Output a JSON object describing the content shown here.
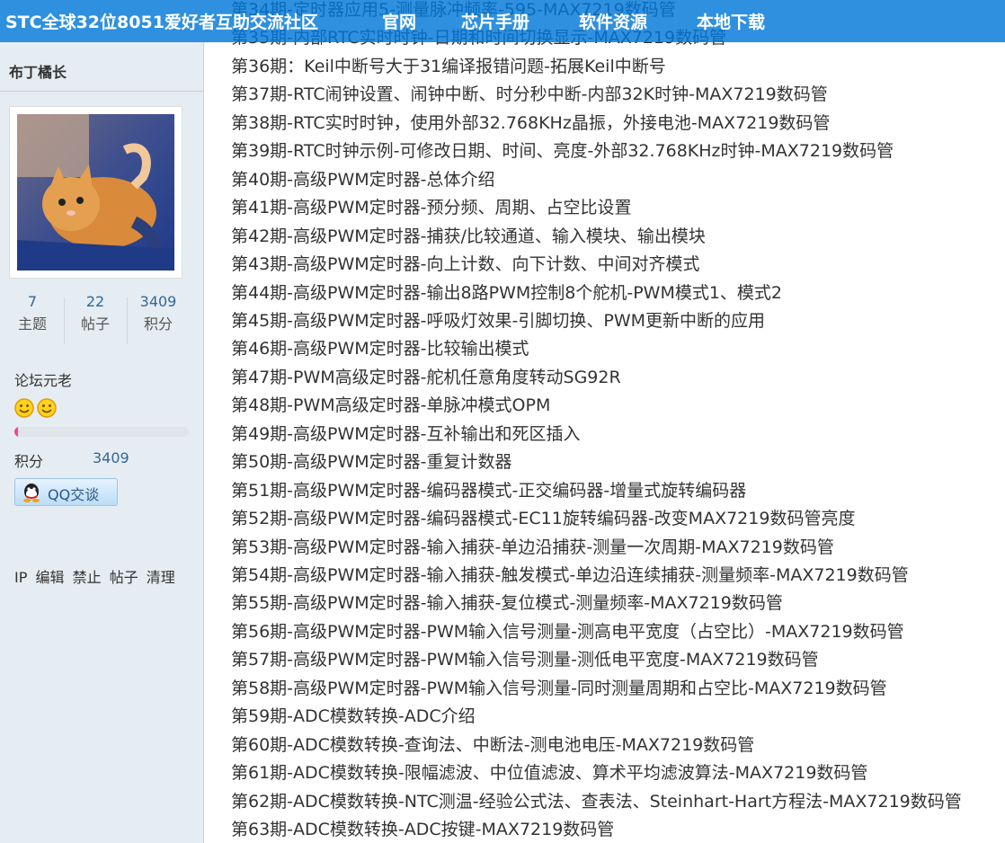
{
  "nav": {
    "site_title": "STC全球32位8051爱好者互助交流社区",
    "items": [
      "官网",
      "芯片手册",
      "软件资源",
      "本地下载"
    ]
  },
  "profile": {
    "username": "布丁橘长",
    "stats": [
      {
        "value": "7",
        "label": "主题"
      },
      {
        "value": "22",
        "label": "帖子"
      },
      {
        "value": "3409",
        "label": "积分"
      }
    ],
    "rank": "论坛元老",
    "progress_fraction": 0.02,
    "points_label": "积分",
    "points_value": "3409",
    "qq_label": "QQ交谈",
    "admin_links": [
      "IP",
      "编辑",
      "禁止",
      "帖子",
      "清理"
    ]
  },
  "lessons": [
    "第34期-定时器应用5-测量脉冲频率-595-MAX7219数码管",
    "第35期-内部RTC实时时钟-日期和时间切换显示-MAX7219数码管",
    "第36期：Keil中断号大于31编译报错问题-拓展Keil中断号",
    "第37期-RTC闹钟设置、闹钟中断、时分秒中断-内部32K时钟-MAX7219数码管",
    "第38期-RTC实时时钟，使用外部32.768KHz晶振，外接电池-MAX7219数码管",
    "第39期-RTC时钟示例-可修改日期、时间、亮度-外部32.768KHz时钟-MAX7219数码管",
    "第40期-高级PWM定时器-总体介绍",
    "第41期-高级PWM定时器-预分频、周期、占空比设置",
    "第42期-高级PWM定时器-捕获/比较通道、输入模块、输出模块",
    "第43期-高级PWM定时器-向上计数、向下计数、中间对齐模式",
    "第44期-高级PWM定时器-输出8路PWM控制8个舵机-PWM模式1、模式2",
    "第45期-高级PWM定时器-呼吸灯效果-引脚切换、PWM更新中断的应用",
    "第46期-高级PWM定时器-比较输出模式",
    "第47期-PWM高级定时器-舵机任意角度转动SG92R",
    "第48期-PWM高级定时器-单脉冲模式OPM",
    "第49期-高级PWM定时器-互补输出和死区插入",
    "第50期-高级PWM定时器-重复计数器",
    "第51期-高级PWM定时器-编码器模式-正交编码器-增量式旋转编码器",
    "第52期-高级PWM定时器-编码器模式-EC11旋转编码器-改变MAX7219数码管亮度",
    "第53期-高级PWM定时器-输入捕获-单边沿捕获-测量一次周期-MAX7219数码管",
    "第54期-高级PWM定时器-输入捕获-触发模式-单边沿连续捕获-测量频率-MAX7219数码管",
    "第55期-高级PWM定时器-输入捕获-复位模式-测量频率-MAX7219数码管",
    "第56期-高级PWM定时器-PWM输入信号测量-测高电平宽度（占空比）-MAX7219数码管",
    "第57期-高级PWM定时器-PWM输入信号测量-测低电平宽度-MAX7219数码管",
    "第58期-高级PWM定时器-PWM输入信号测量-同时测量周期和占空比-MAX7219数码管",
    "第59期-ADC模数转换-ADC介绍",
    "第60期-ADC模数转换-查询法、中断法-测电池电压-MAX7219数码管",
    "第61期-ADC模数转换-限幅滤波、中位值滤波、算术平均滤波算法-MAX7219数码管",
    "第62期-ADC模数转换-NTC测温-经验公式法、查表法、Steinhart-Hart方程法-MAX7219数码管",
    "第63期-ADC模数转换-ADC按键-MAX7219数码管"
  ]
}
